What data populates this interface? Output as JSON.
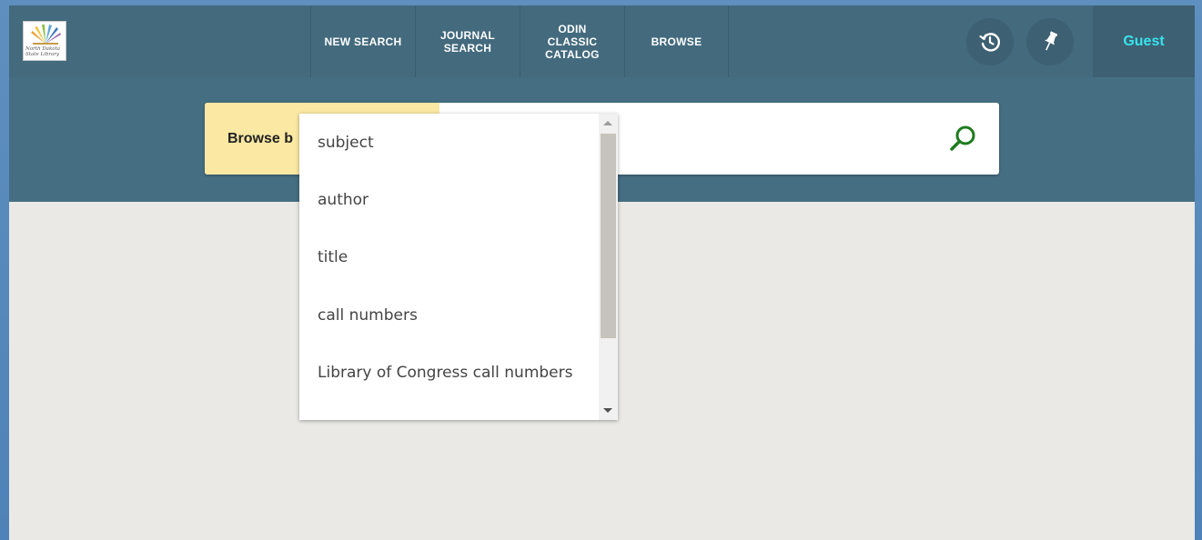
{
  "header": {
    "logo_text": "North Dakota State Library",
    "nav": [
      {
        "label": "NEW SEARCH"
      },
      {
        "label": "JOURNAL\nSEARCH"
      },
      {
        "label": "ODIN\nCLASSIC\nCATALOG"
      },
      {
        "label": "BROWSE"
      }
    ],
    "history_icon": "history-icon",
    "pin_icon": "pin-icon",
    "user_label": "Guest"
  },
  "search": {
    "browse_by_label": "Browse b",
    "input_value": "",
    "search_icon": "magnifier-icon"
  },
  "dropdown": {
    "options": [
      {
        "label": "subject"
      },
      {
        "label": "author"
      },
      {
        "label": "title"
      },
      {
        "label": "call numbers"
      },
      {
        "label": "Library of Congress call numbers"
      }
    ]
  },
  "colors": {
    "header_bg": "#436a7d",
    "search_band_bg": "#466e82",
    "guest_text": "#38e3ee",
    "browse_by_bg": "#fbe8a3",
    "search_icon": "#1e7b1e",
    "page_bg": "#eae9e5"
  }
}
